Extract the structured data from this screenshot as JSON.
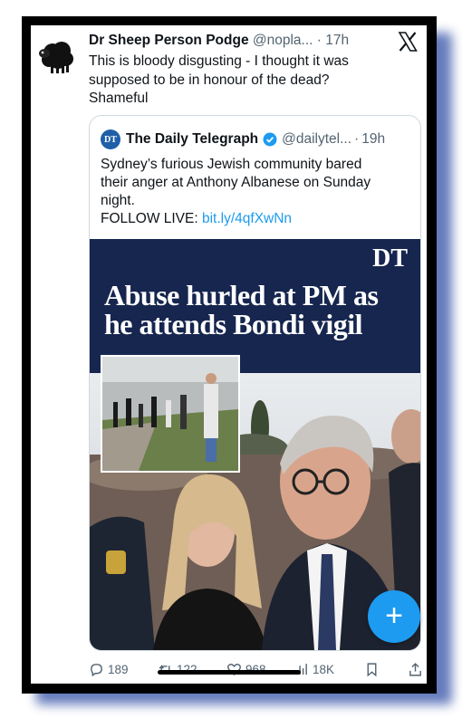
{
  "tweet": {
    "author_name": "Dr Sheep Person Podge",
    "author_handle": "@nopla...",
    "separator": "·",
    "time": "17h",
    "text_lines": [
      "This is bloody disgusting - I thought it was",
      "supposed to be in honour of the dead?",
      "Shameful"
    ]
  },
  "quote": {
    "badge": "DT",
    "source_name": "The Daily Telegraph",
    "handle": "@dailytel...",
    "separator": "·",
    "time": "19h",
    "text_lines": [
      "Sydney’s furious Jewish community bared",
      "their anger at Anthony Albanese on Sunday",
      "night."
    ],
    "follow_label": "FOLLOW LIVE: ",
    "follow_link": "bit.ly/4qfXwNn"
  },
  "media": {
    "banner_logo": "DT",
    "headline_lines": [
      "Abuse hurled at PM as",
      "he attends Bondi vigil"
    ]
  },
  "actions": {
    "replies": "189",
    "reposts": "122",
    "likes": "968",
    "views": "18K"
  },
  "icons": {
    "close": "x-logo-icon",
    "reply": "reply-icon",
    "repost": "repost-icon",
    "like": "heart-icon",
    "views": "views-icon",
    "bookmark": "bookmark-icon",
    "share": "share-icon",
    "compose": "plus-icon"
  },
  "colors": {
    "accent": "#1d9bf0",
    "banner": "#16264f",
    "frame_shadow": "#4a64b0"
  }
}
